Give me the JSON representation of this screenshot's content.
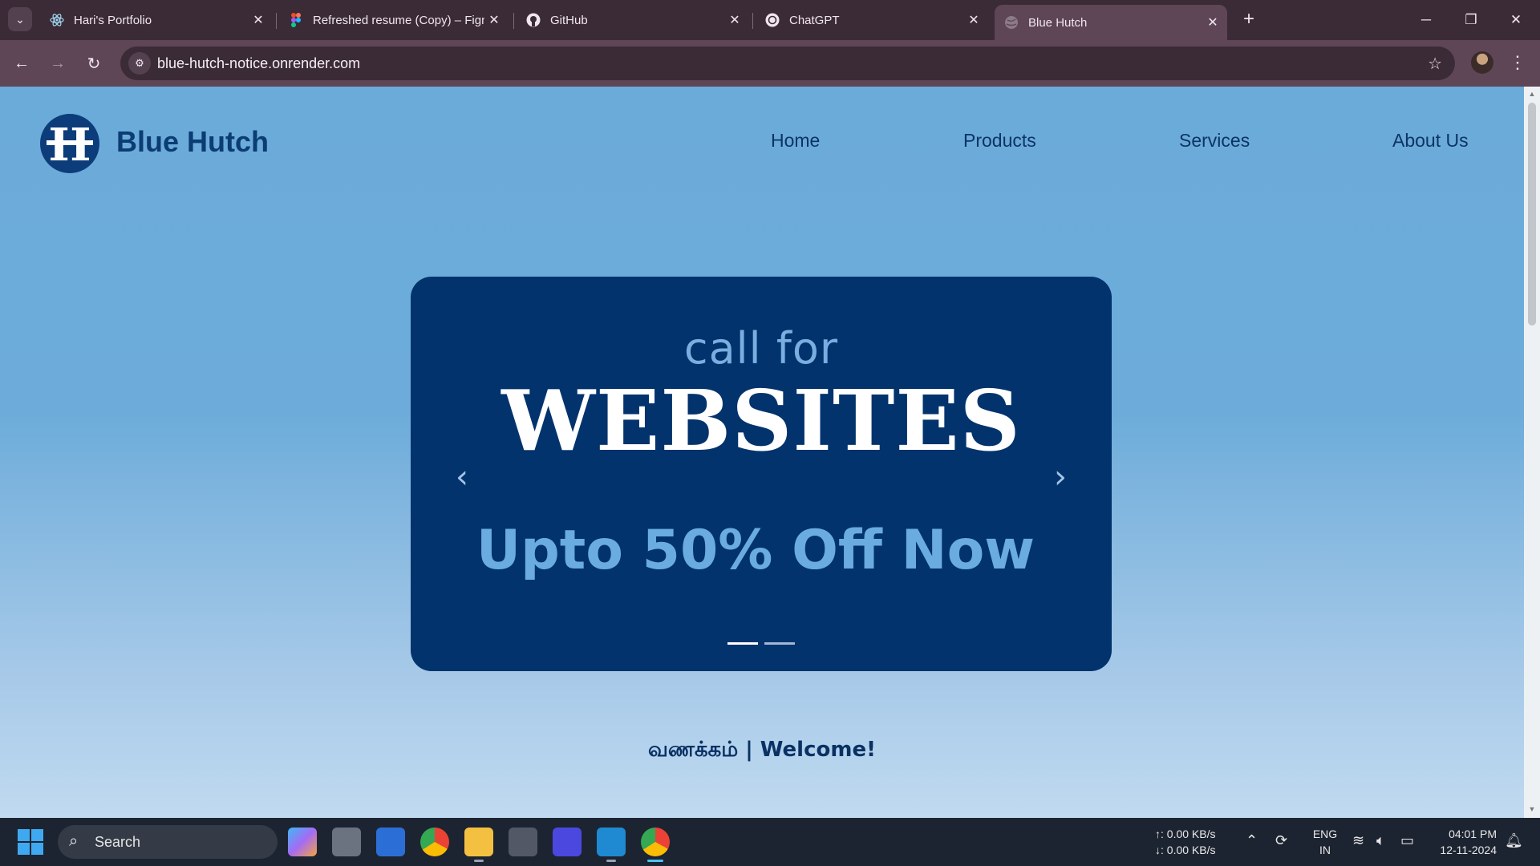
{
  "browser": {
    "tabs": [
      {
        "title": "Hari's Portfolio",
        "icon": "react-icon",
        "active": false
      },
      {
        "title": "Refreshed resume (Copy) – Figma",
        "icon": "figma-icon",
        "active": false
      },
      {
        "title": "GitHub",
        "icon": "github-icon",
        "active": false
      },
      {
        "title": "ChatGPT",
        "icon": "chatgpt-icon",
        "active": false
      },
      {
        "title": "Blue Hutch",
        "icon": "globe-icon",
        "active": true
      }
    ],
    "url": "blue-hutch-notice.onrender.com"
  },
  "site": {
    "logo_letter": "H",
    "name": "Blue Hutch",
    "nav": [
      "Home",
      "Products",
      "Services",
      "About Us"
    ],
    "hero": {
      "eyebrow": "call for",
      "headline": "WEBSITES",
      "offer": "Upto 50% Off Now",
      "slides_total": 2,
      "active_slide": 1
    },
    "welcome": "வணக்கம் | Welcome!"
  },
  "taskbar": {
    "search_placeholder": "Search",
    "apps": [
      "copilot-icon",
      "task-view-icon",
      "widgets-icon",
      "chrome-icon",
      "file-explorer-icon",
      "unity-icon",
      "cursor-ide-icon",
      "vscode-icon",
      "chrome-profile-icon"
    ],
    "net_up": "↑: 0.00 KB/s",
    "net_down": "↓: 0.00 KB/s",
    "lang_top": "ENG",
    "lang_bottom": "IN",
    "time": "04:01 PM",
    "date": "12-11-2024"
  },
  "colors": {
    "page_top": "#6babd9",
    "page_bottom": "#c0daf0",
    "hero_bg": "#02336d",
    "brand": "#0b3c74",
    "accent": "#6aabe0"
  }
}
